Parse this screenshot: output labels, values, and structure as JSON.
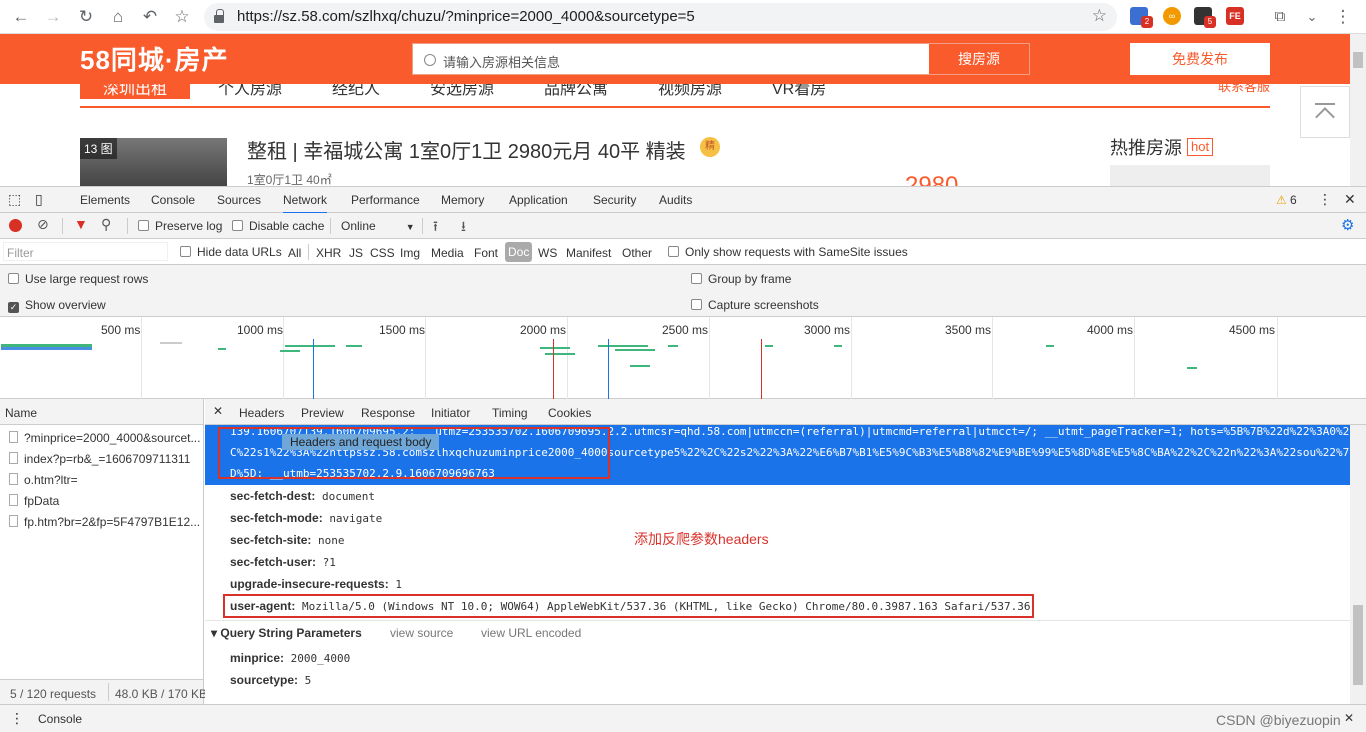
{
  "browser": {
    "url": "https://sz.58.com/szlhxq/chuzu/?minprice=2000_4000&sourcetype=5",
    "ext_badges": [
      "2",
      "5"
    ]
  },
  "page": {
    "logo": "58同城·房产",
    "search_placeholder": "请输入房源相关信息",
    "search_button": "搜房源",
    "publish_button": "免费发布",
    "nav": [
      "深圳出租",
      "个人房源",
      "经纪人",
      "安选房源",
      "品牌公寓",
      "视频房源",
      "VR看房"
    ],
    "nav_right": "联系客服",
    "listing": {
      "image_count": "13 图",
      "title": "整租 | 幸福城公寓 1室0厅1卫 2980元月 40平 精装",
      "badge": "精",
      "subtitle": "1室0厅1卫    40㎡",
      "price": "2980"
    },
    "hot_title": "热推房源",
    "hot_tag": "hot"
  },
  "devtools": {
    "tabs": [
      "Elements",
      "Console",
      "Sources",
      "Network",
      "Performance",
      "Memory",
      "Application",
      "Security",
      "Audits"
    ],
    "active_tab": "Network",
    "warning_count": "6",
    "toolbar": {
      "preserve_log": "Preserve log",
      "disable_cache": "Disable cache",
      "throttle": "Online"
    },
    "filter": {
      "placeholder": "Filter",
      "hide_data_urls": "Hide data URLs",
      "types": [
        "All",
        "XHR",
        "JS",
        "CSS",
        "Img",
        "Media",
        "Font",
        "Doc",
        "WS",
        "Manifest",
        "Other"
      ],
      "active_type": "Doc",
      "same_site": "Only show requests with SameSite issues"
    },
    "settings": {
      "large_rows": "Use large request rows",
      "show_overview": "Show overview",
      "group_by_frame": "Group by frame",
      "capture_screenshots": "Capture screenshots"
    },
    "overview_ticks": [
      "500 ms",
      "1000 ms",
      "1500 ms",
      "2000 ms",
      "2500 ms",
      "3000 ms",
      "3500 ms",
      "4000 ms",
      "4500 ms"
    ],
    "name_header": "Name",
    "requests": [
      "?minprice=2000_4000&sourcet...",
      "index?p=rb&_=1606709711311",
      "o.htm?ltr=",
      "fpData",
      "fp.htm?br=2&fp=5F4797B1E12..."
    ],
    "status": {
      "requests": "5 / 120 requests",
      "size": "48.0 KB / 170 KB"
    },
    "detail_tabs": [
      "Headers",
      "Preview",
      "Response",
      "Initiator",
      "Timing",
      "Cookies"
    ],
    "active_detail_tab": "Headers",
    "cookie_lines": [
      "139.1606707139.1606709695.2;  __utmz=253535702.1606709695.2.2.utmcsr=qhd.58.com|utmccn=(referral)|utmcmd=referral|utmcct=/; __utmt_pageTracker=1; hots=%5B%7B%22d%22%3A0%2",
      "C%22s1%22%3A%22httpssz.58.comszlhxqchuzuminprice2000_4000sourcetype5%22%2C%22s2%22%3A%22%E6%B7%B1%E5%9C%B3%E5%B8%82%E9%BE%99%E5%8D%8E%E5%8C%BA%22%2C%22n%22%3A%22sou%22%7",
      "D%5D;  __utmb=253535702.2.9.1606709696763"
    ],
    "tooltip": "Headers and request body",
    "headers": [
      {
        "name": "sec-fetch-dest:",
        "value": "document"
      },
      {
        "name": "sec-fetch-mode:",
        "value": "navigate"
      },
      {
        "name": "sec-fetch-site:",
        "value": "none"
      },
      {
        "name": "sec-fetch-user:",
        "value": "?1"
      },
      {
        "name": "upgrade-insecure-requests:",
        "value": "1"
      },
      {
        "name": "user-agent:",
        "value": "Mozilla/5.0 (Windows NT 10.0; WOW64) AppleWebKit/537.36 (KHTML, like Gecko) Chrome/80.0.3987.163 Safari/537.36"
      }
    ],
    "annotation": "添加反爬参数headers",
    "query_section": {
      "title": "Query String Parameters",
      "view_source": "view source",
      "view_url_encoded": "view URL encoded",
      "params": [
        {
          "name": "minprice:",
          "value": "2000_4000"
        },
        {
          "name": "sourcetype:",
          "value": "5"
        }
      ]
    },
    "drawer_tab": "Console",
    "watermark": "CSDN @biyezuopin"
  }
}
